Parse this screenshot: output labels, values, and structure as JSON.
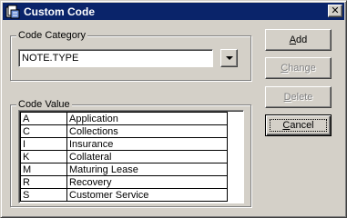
{
  "window": {
    "title": "Custom Code",
    "close_glyph": "✕"
  },
  "code_category": {
    "legend": "Code Category",
    "value": "NOTE.TYPE"
  },
  "code_value": {
    "legend": "Code Value",
    "rows": [
      {
        "code": "A",
        "description": "Application"
      },
      {
        "code": "C",
        "description": "Collections"
      },
      {
        "code": "I",
        "description": "Insurance"
      },
      {
        "code": "K",
        "description": "Collateral"
      },
      {
        "code": "M",
        "description": "Maturing Lease"
      },
      {
        "code": "R",
        "description": "Recovery"
      },
      {
        "code": "S",
        "description": "Customer Service"
      }
    ]
  },
  "buttons": {
    "add": {
      "mnemonic": "A",
      "rest": "dd",
      "enabled": true
    },
    "change": {
      "mnemonic": "C",
      "rest": "hange",
      "enabled": false
    },
    "delete": {
      "mnemonic": "D",
      "rest": "elete",
      "enabled": false
    },
    "cancel": {
      "mnemonic": "C",
      "rest": "ancel",
      "enabled": true,
      "default": true
    }
  }
}
